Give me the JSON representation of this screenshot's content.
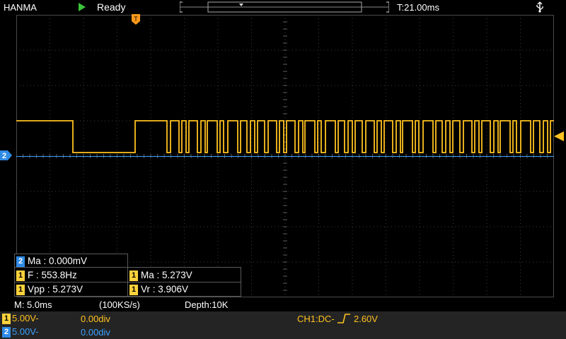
{
  "topbar": {
    "brand": "HANMA",
    "status": "Ready",
    "timebase_offset": "T:21.00ms"
  },
  "icons": {
    "run": "play-icon",
    "usb": "usb-icon",
    "trigger_pos": "trigger-position-marker",
    "ch2": "ch2-marker",
    "trigger_level": "trigger-level-arrow"
  },
  "markers": {
    "trigger": "T",
    "ch2": "2"
  },
  "measurements": {
    "ch2_ma": {
      "ch": "2",
      "text": "Ma : 0.000mV"
    },
    "ch1_freq": {
      "ch": "1",
      "text": "F : 553.8Hz"
    },
    "ch1_ma": {
      "ch": "1",
      "text": "Ma : 5.273V"
    },
    "ch1_vpp": {
      "ch": "1",
      "text": "Vpp : 5.273V"
    },
    "ch1_vr": {
      "ch": "1",
      "text": "Vr : 3.906V"
    }
  },
  "acq": {
    "timebase": "M: 5.0ms",
    "sample_rate": "(100KS/s)",
    "depth": "Depth:10K"
  },
  "channels": [
    {
      "ch": "1",
      "scale": "5.00V-",
      "offset": "0.00div"
    },
    {
      "ch": "2",
      "scale": "5.00V-",
      "offset": "0.00div"
    }
  ],
  "trigger": {
    "coupling": "CH1:DC-",
    "level": "2.60V"
  },
  "colors": {
    "ch1": "#ffc21f",
    "ch2": "#3aa0ff",
    "grid": "#3c3c3c",
    "run": "#3ac43a"
  }
}
